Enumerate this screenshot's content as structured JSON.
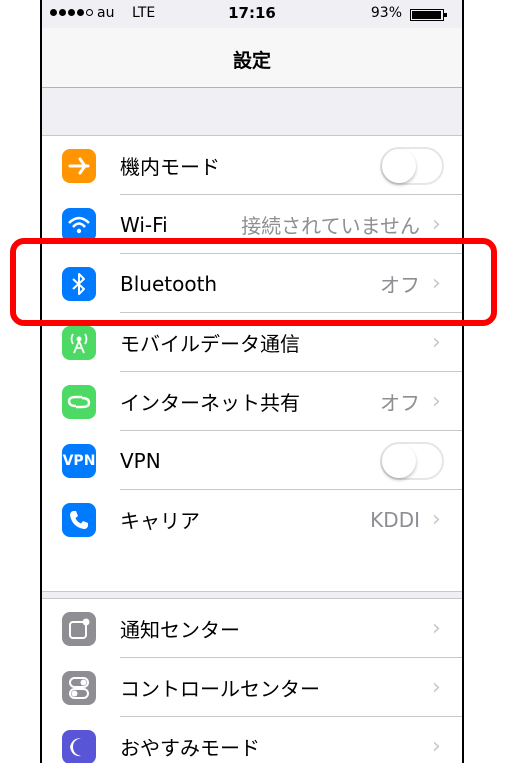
{
  "statusbar": {
    "carrier": "au",
    "network": "LTE",
    "time": "17:16",
    "battery": "93%"
  },
  "navbar": {
    "title": "設定"
  },
  "rows": [
    {
      "label": "機内モード",
      "icon": "airplane-icon",
      "color": "#ff9500",
      "value": "",
      "toggle": true
    },
    {
      "label": "Wi-Fi",
      "icon": "wifi-icon",
      "color": "#007aff",
      "value": "接続されていません"
    },
    {
      "label": "Bluetooth",
      "icon": "bluetooth-icon",
      "color": "#007aff",
      "value": "オフ"
    },
    {
      "label": "モバイルデータ通信",
      "icon": "antenna-icon",
      "color": "#4cd964",
      "value": ""
    },
    {
      "label": "インターネット共有",
      "icon": "hotspot-icon",
      "color": "#4cd964",
      "value": "オフ"
    },
    {
      "label": "VPN",
      "icon": "vpn-icon",
      "icon_text": "VPN",
      "color": "#007aff",
      "value": "",
      "toggle": true
    },
    {
      "label": "キャリア",
      "icon": "phone-icon",
      "color": "#007aff",
      "value": "KDDI"
    }
  ],
  "rows2": [
    {
      "label": "通知センター",
      "icon": "notification-center-icon",
      "color": "#8e8e93"
    },
    {
      "label": "コントロールセンター",
      "icon": "control-center-icon",
      "color": "#8e8e93"
    },
    {
      "label": "おやすみモード",
      "icon": "moon-icon",
      "color": "#5856d6"
    }
  ],
  "highlight_color": "#ff0000"
}
